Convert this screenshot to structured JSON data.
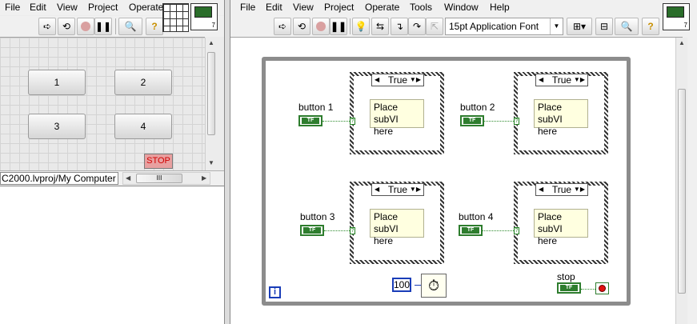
{
  "front_panel": {
    "menus": [
      "File",
      "Edit",
      "View",
      "Project",
      "Operate"
    ],
    "toolbar_icons": [
      "run-arrow",
      "run-continuously",
      "abort",
      "pause",
      "search",
      "help"
    ],
    "buttons": [
      "1",
      "2",
      "3",
      "4"
    ],
    "stop_label": "STOP",
    "project_path": "C2000.lvproj/My Computer",
    "hscroll_grip": "III"
  },
  "block_diagram": {
    "menus": [
      "File",
      "Edit",
      "View",
      "Project",
      "Operate",
      "Tools",
      "Window",
      "Help"
    ],
    "font_select": "15pt Application Font",
    "case_value": "True",
    "subvi_text": [
      "Place subVI",
      "here"
    ],
    "button_labels": [
      "button 1",
      "button 2",
      "button 3",
      "button 4"
    ],
    "tf_text": "TF",
    "wait_ms": "100",
    "stop_label": "stop",
    "loop_iteration": "i",
    "case_terminal": "?"
  },
  "colors": {
    "boolean_wire": "#2e8b2e",
    "numeric_blue": "#1a3db8",
    "stop_red": "#d00000"
  }
}
